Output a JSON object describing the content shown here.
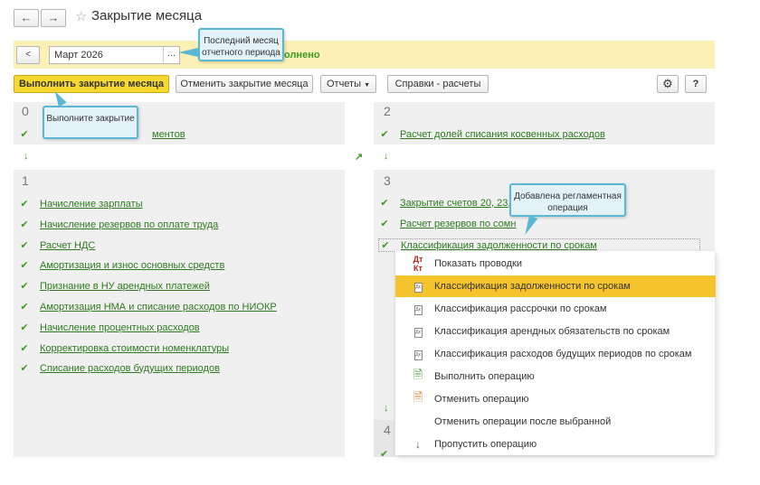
{
  "window": {
    "title": "Закрытие месяца",
    "back_icon": "arrow-left-icon",
    "forward_icon": "arrow-right-icon",
    "favorite_icon": "star-icon"
  },
  "period": {
    "prev_label": "<",
    "month": "Март 2026",
    "select_label": "...",
    "status_text": "олнено"
  },
  "toolbar": {
    "run_close": "Выполнить закрытие месяца",
    "cancel_close": "Отменить закрытие месяца",
    "reports": "Отчеты",
    "references": "Справки - расчеты",
    "help": "?"
  },
  "callouts": {
    "last_month": "Последний месяц отчетного периода",
    "run": "Выполните закрытие",
    "added": "Добавлена регламентная операция"
  },
  "stages": {
    "s0": {
      "number": "0",
      "ops": [
        "ментов"
      ]
    },
    "s1": {
      "number": "1",
      "ops": [
        "Начисление зарплаты",
        "Начисление резервов по оплате труда",
        "Расчет НДС",
        "Амортизация и износ основных средств",
        "Признание в НУ арендных платежей",
        "Амортизация НМА и списание расходов по НИОКР",
        "Начисление процентных расходов",
        "Корректировка стоимости номенклатуры",
        "Списание расходов будущих периодов"
      ]
    },
    "s2": {
      "number": "2",
      "ops": [
        "Расчет долей списания косвенных расходов"
      ]
    },
    "s3": {
      "number": "3",
      "ops": [
        "Закрытие счетов 20, 23, 2",
        "Расчет резервов по сомн",
        "Классификация задолженности по срокам"
      ]
    },
    "s4": {
      "number": "4"
    }
  },
  "context_menu": {
    "items": [
      "Показать проводки",
      "Классификация задолженности по срокам",
      "Классификация рассрочки по срокам",
      "Классификация арендных обязательств по срокам",
      "Классификация расходов будущих периодов по срокам",
      "Выполнить операцию",
      "Отменить операцию",
      "Отменить операции после выбранной",
      "Пропустить операцию"
    ],
    "active_index": 1
  },
  "colors": {
    "accent_yellow": "#f7d82e",
    "done_green": "#3f9a22",
    "callout_border": "#5ab8d5",
    "underline_red": "#e0161c"
  }
}
